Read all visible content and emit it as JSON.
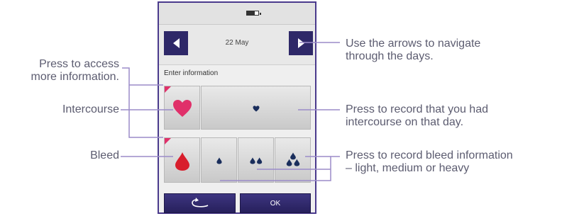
{
  "device": {
    "date": "22 May",
    "enter_info_label": "Enter information",
    "ok_label": "OK",
    "icons": {
      "battery": "battery-icon",
      "prev": "arrow-left-icon",
      "next": "arrow-right-icon",
      "heart": "heart-icon",
      "drop": "drop-icon",
      "back": "return-arrow-icon"
    },
    "colors": {
      "frame": "#4a3a8c",
      "button": "#2e2868",
      "heart": "#e0306a",
      "drop": "#d81e2c",
      "small_icon": "#1a2e5c"
    }
  },
  "callouts": {
    "press_access_line1": "Press to access",
    "press_access_line2": "more information.",
    "intercourse": "Intercourse",
    "bleed": "Bleed",
    "arrows_line1": "Use the arrows to navigate",
    "arrows_line2": "through the days.",
    "record_intercourse_line1": "Press to record that you had",
    "record_intercourse_line2": "intercourse on that day.",
    "record_bleed_line1": "Press to record bleed information",
    "record_bleed_line2": "– light, medium or heavy"
  }
}
